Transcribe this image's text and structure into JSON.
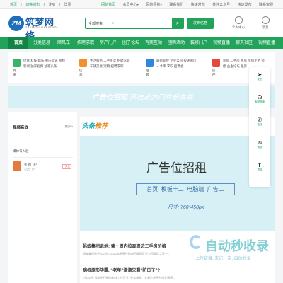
{
  "topbar": {
    "welcome": "首页",
    "links": [
      "|",
      "切换城市",
      "|",
      "注册",
      "|",
      "登录"
    ],
    "right": [
      "网站首页",
      "会员中心▾",
      "网站导航▾",
      "联系我们",
      "快速发布",
      "关注公众号",
      "快速发布",
      "联系客服"
    ]
  },
  "logo": {
    "mark": "ZM",
    "name": "筑梦网络",
    "sub": "ZHUMENGWANGLUO"
  },
  "search": {
    "select": "全部搜索",
    "button_icon": "search-icon"
  },
  "post_button": "发布信息",
  "header_icons": [
    "个人中心",
    "消息"
  ],
  "nav": [
    "首页",
    "分类信息",
    "顺风车",
    "招聘求职",
    "房产门户",
    "圈子论坛",
    "有奖互动",
    "团购活动",
    "装修门户",
    "视频直播",
    "聊天社区",
    "视频直播"
  ],
  "categories": [
    {
      "name": "资讯",
      "color": "#3bb36d",
      "links": "体育  科技  娱乐  重庆资讯  视频新闻  独家视频  独家头条"
    },
    {
      "name": "信息",
      "color": "#f28f2e",
      "links": "生活服务  二手买卖  招聘求职  车辆交易  宠物  招聘求职"
    },
    {
      "name": "招聘",
      "color": "#2f86e0",
      "links": "最新职位  企业公司  投递简历  人才库  求职  招聘会"
    },
    {
      "name": "房产",
      "color": "#e5483f",
      "links": "新房  二手房  租房  房价走势  装修  业主论坛  租房"
    }
  ],
  "banner": {
    "bold": "广告位招租",
    "rest": " 开启地方门户新未来"
  },
  "sidebar": {
    "title": "视频亲放",
    "more": "更多>",
    "section": "媒体号入驻",
    "entry": {
      "name": "火箭门户",
      "sub": "火箭门户",
      "tag": "+关注"
    }
  },
  "main": {
    "title_a": "头条",
    "title_b": "推荐",
    "more": "更多>",
    "ad": {
      "line1": "广告位招租",
      "line2": "首页_模板十二_电脑端_广告二",
      "line3": "尺寸: 760*450px"
    },
    "news": [
      {
        "title": "蚂蚁集团退地: 曾一周内拉高周边二手房价格",
        "desc": "蚂蚁集团曾于2022年, 2021年曾落户杭州西溪园区并为西湖区之区一..."
      },
      {
        "title": "病根原形毕露, “老年”滴滴只剩“防日子”?",
        "desc": "7月28日, 重庆出行新的审核工作正式, 外卖单据、交易产出平台相关通报..."
      }
    ]
  },
  "floater": [
    "发布",
    "客服咨询",
    "电话",
    "微信",
    "顶部"
  ],
  "watermark": {
    "big": "自动秒收录",
    "small": "上传链接, 来访一次, 自动收录"
  }
}
